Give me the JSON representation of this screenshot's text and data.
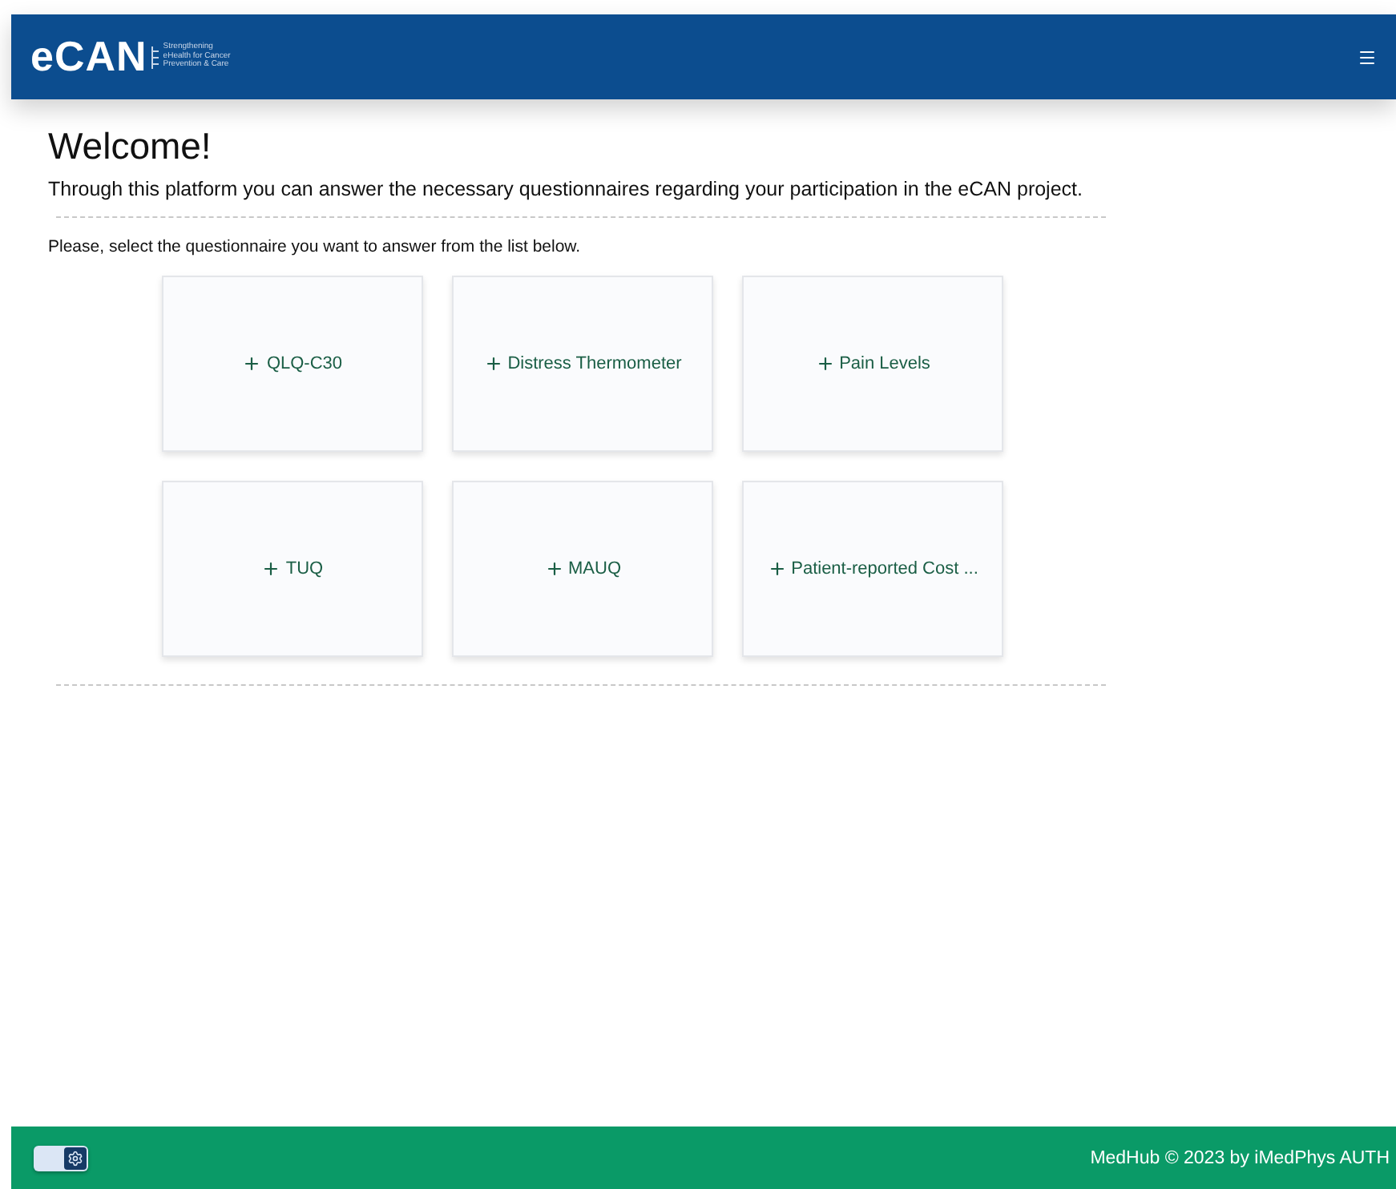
{
  "header": {
    "logo": "eCAN",
    "tagline": [
      "Strengthening",
      "eHealth for Cancer",
      "Prevention & Care"
    ]
  },
  "main": {
    "title": "Welcome!",
    "intro": "Through this platform you can answer the necessary questionnaires regarding your participation in the eCAN project.",
    "instruction": "Please, select the questionnaire you want to answer from the list below.",
    "questionnaires": [
      {
        "label": "QLQ-C30"
      },
      {
        "label": "Distress Thermometer"
      },
      {
        "label": "Pain Levels"
      },
      {
        "label": "TUQ"
      },
      {
        "label": "MAUQ"
      },
      {
        "label": "Patient-reported Cost ..."
      }
    ]
  },
  "footer": {
    "theme_toggle": {
      "on": true
    },
    "credit": "MedHub © 2023 by iMedPhys AUTH"
  }
}
